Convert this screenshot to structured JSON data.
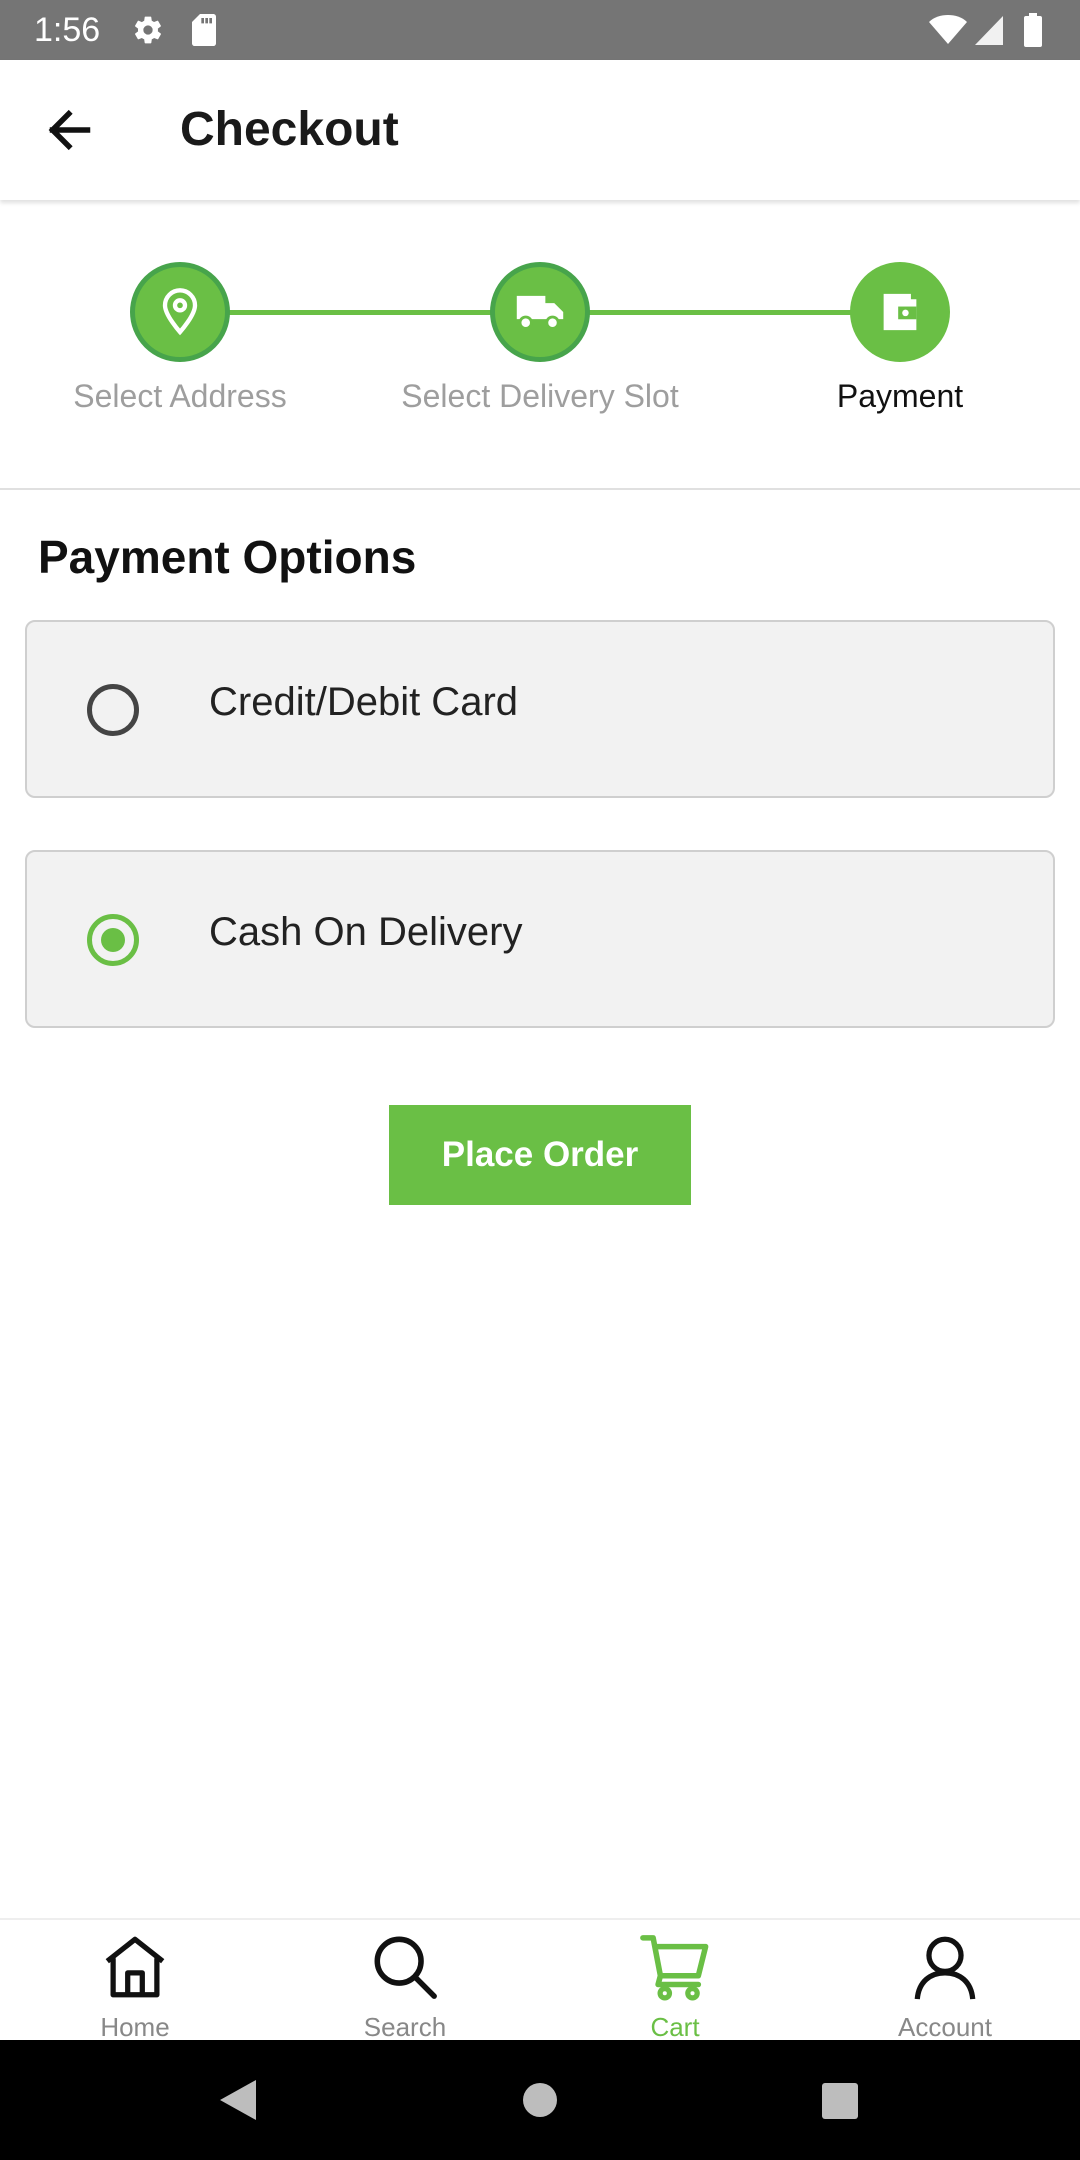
{
  "status_bar": {
    "time": "1:56",
    "icons": [
      "gear-icon",
      "sd-card-icon",
      "wifi-icon",
      "signal-icon",
      "battery-icon"
    ]
  },
  "app_bar": {
    "title": "Checkout",
    "back_icon": "arrow-left-icon"
  },
  "stepper": {
    "steps": [
      {
        "label": "Select Address",
        "icon": "location-pin-icon",
        "active": false
      },
      {
        "label": "Select Delivery Slot",
        "icon": "truck-icon",
        "active": false
      },
      {
        "label": "Payment",
        "icon": "wallet-icon",
        "active": true
      }
    ]
  },
  "payment": {
    "title": "Payment Options",
    "options": [
      {
        "label": "Credit/Debit Card",
        "selected": false
      },
      {
        "label": "Cash On Delivery",
        "selected": true
      }
    ],
    "place_order_label": "Place Order"
  },
  "bottom_nav": {
    "items": [
      {
        "label": "Home",
        "icon": "home-icon",
        "active": false
      },
      {
        "label": "Search",
        "icon": "search-icon",
        "active": false
      },
      {
        "label": "Cart",
        "icon": "cart-icon",
        "active": true
      },
      {
        "label": "Account",
        "icon": "account-icon",
        "active": false
      }
    ]
  },
  "colors": {
    "accent": "#6abf45",
    "accent_dark": "#47a44b",
    "status_bar": "#757575",
    "card_bg": "#f2f2f2"
  }
}
